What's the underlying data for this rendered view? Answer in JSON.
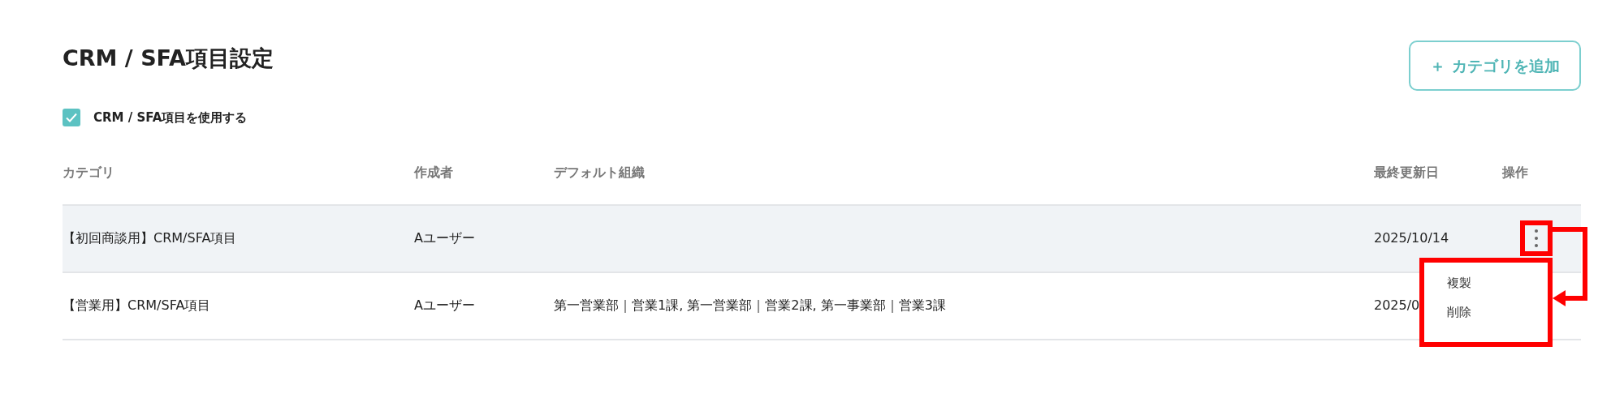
{
  "title": "CRM / SFA項目設定",
  "use_setting": {
    "label": "CRM / SFA項目を使用する",
    "checked": true
  },
  "add_button": {
    "icon": "＋",
    "label": "カテゴリを追加"
  },
  "table": {
    "columns": [
      "カテゴリ",
      "作成者",
      "デフォルト組織",
      "最終更新日",
      "操作"
    ],
    "rows": [
      {
        "category": "【初回商談用】CRM/SFA項目",
        "creator": "Aユーザー",
        "default_org": "",
        "updated": "2025/10/14",
        "highlighted": true,
        "menu_open": true
      },
      {
        "category": "【営業用】CRM/SFA項目",
        "creator": "Aユーザー",
        "default_org": "第一営業部｜営業1課, 第一営業部｜営業2課, 第一事業部｜営業3課",
        "updated": "2025/0",
        "highlighted": false,
        "menu_open": false
      }
    ]
  },
  "row_menu": {
    "items": [
      "複製",
      "削除"
    ]
  }
}
